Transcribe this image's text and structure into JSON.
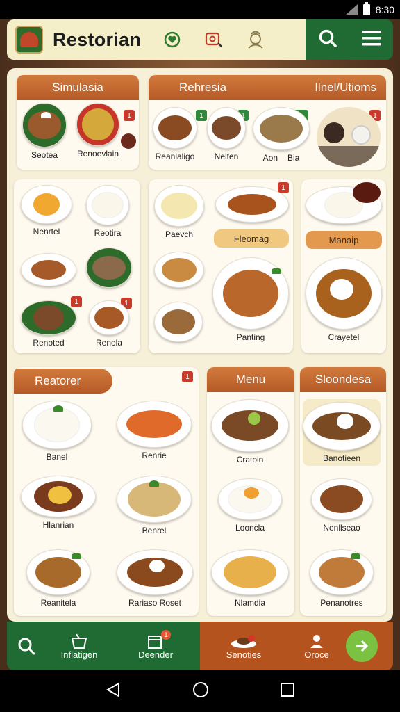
{
  "status_bar": {
    "time": "8:30"
  },
  "header": {
    "title": "Restorian"
  },
  "sections": {
    "simulasia": {
      "title": "Simulasia",
      "badge": "1",
      "items": [
        {
          "label": "Seotea"
        },
        {
          "label": "Renoevlain"
        }
      ]
    },
    "rehresia": {
      "title": "Rehresia",
      "subtitle": "Ilnel/Utioms",
      "badges": [
        "1",
        "1",
        "1",
        "1",
        "1"
      ],
      "items": [
        {
          "label": "Reanlaligo"
        },
        {
          "label": "Nelten"
        },
        {
          "label": "Aon"
        },
        {
          "label": "Bia"
        }
      ]
    },
    "grid_a": {
      "items": [
        {
          "label": "Nenrtel"
        },
        {
          "label": "Reotira"
        },
        {
          "label": "Renoted"
        },
        {
          "label": "Renola"
        }
      ],
      "badges": [
        "1",
        "1"
      ]
    },
    "grid_b": {
      "items": [
        {
          "label": "Paevch"
        },
        {
          "label": "Panting"
        }
      ],
      "pill": "Fleomag",
      "badge": "1"
    },
    "grid_c": {
      "pill": "Manaip",
      "items": [
        {
          "label": "Crayetel"
        }
      ]
    },
    "restorer": {
      "title": "Reatorer",
      "badge": "1",
      "items": [
        {
          "label": "Banel"
        },
        {
          "label": "Renrie"
        },
        {
          "label": "Hlanrian"
        },
        {
          "label": "Benrel"
        },
        {
          "label": "Reanitela"
        },
        {
          "label": "Rariaso Roset"
        }
      ]
    },
    "menu": {
      "title": "Menu",
      "items": [
        {
          "label": "Cratoin"
        },
        {
          "label": "Looncla"
        },
        {
          "label": "Nlamdia"
        }
      ]
    },
    "sloondesa": {
      "title": "Sloondesa",
      "items": [
        {
          "label": "Banotieen"
        },
        {
          "label": "Nenllseao"
        },
        {
          "label": "Penanotres"
        }
      ]
    }
  },
  "bottom_nav": {
    "items": [
      {
        "label": "Inflatigen"
      },
      {
        "label": "Deender"
      },
      {
        "label": "Senoties"
      },
      {
        "label": "Oroce"
      }
    ],
    "badge": "1"
  },
  "colors": {
    "header_bg": "#f4efc8",
    "header_green": "#1f6b33",
    "section_orange": "#c06a30",
    "panel_bg": "#f7f0d9",
    "nav_orange": "#b5531f",
    "go_green": "#7cc242"
  },
  "icons": {
    "header": [
      "heart-badge-icon",
      "search-map-icon",
      "chef-icon",
      "search-icon",
      "menu-icon"
    ],
    "bottom_nav": [
      "search-icon",
      "basket-icon",
      "calendar-icon",
      "dish-icon",
      "person-icon",
      "arrow-right-icon"
    ]
  }
}
